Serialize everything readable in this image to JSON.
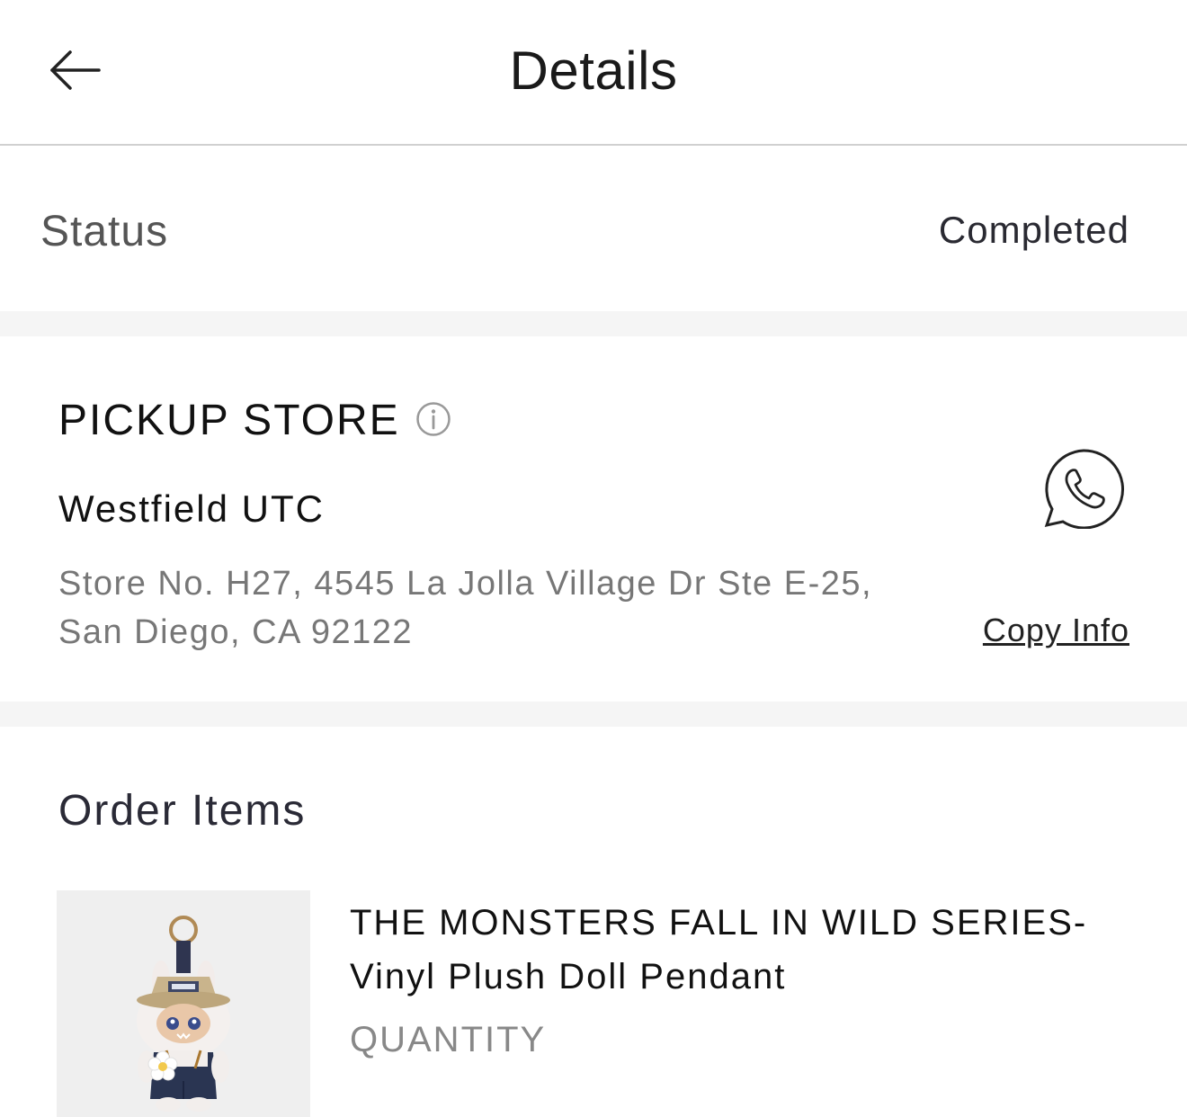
{
  "header": {
    "title": "Details",
    "back_icon": "arrow-left-icon"
  },
  "status": {
    "label": "Status",
    "value": "Completed"
  },
  "pickup_store": {
    "heading": "PICKUP STORE",
    "info_icon": "info-icon",
    "name": "Westfield UTC",
    "address_line1": "Store No. H27, 4545 La Jolla Village Dr Ste E-25,",
    "address_line2": "San Diego, CA 92122",
    "contact_icon": "whatsapp-icon",
    "copy_label": "Copy Info"
  },
  "order_items": {
    "heading": "Order Items",
    "items": [
      {
        "title_line1": "THE MONSTERS FALL IN WILD SERIES-",
        "title_line2": "Vinyl Plush Doll Pendant",
        "quantity_label": "QUANTITY"
      }
    ]
  },
  "colors": {
    "divider": "#f5f5f5",
    "muted_text": "#777777"
  }
}
